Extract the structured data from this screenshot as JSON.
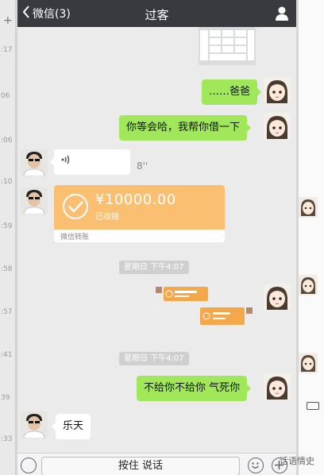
{
  "left_strip": {
    "times": [
      ":17",
      "06",
      ":06",
      ":10",
      ":59",
      ":58",
      ":57",
      ":41",
      "39",
      ":33"
    ],
    "plus": "+"
  },
  "header": {
    "back_label": "微信(3)",
    "title": "过客"
  },
  "messages": {
    "m1": "……爸爸",
    "m2": "你等会哈，我帮你借一下",
    "voice_duration": "8''",
    "transfer_amount": "¥10000.00",
    "transfer_status": "已收钱",
    "transfer_footer": "微信转账",
    "time1": "星期日 下午4:07",
    "time2": "星期日 下午4:07",
    "m3": "不给你不给你 气死你",
    "m4": "乐天"
  },
  "bottom": {
    "hold_label": "按住 说话"
  },
  "watermark": "话语情史",
  "colors": {
    "green_bubble": "#a0e75a",
    "transfer_orange": "#fbbf72",
    "topbar": "#393a3f"
  },
  "icons": {
    "back": "chevron-left-icon",
    "user": "user-icon",
    "keyboard": "keyboard-icon",
    "emoji": "emoji-icon",
    "plus": "plus-icon",
    "voice": "voice-wave-icon",
    "check": "check-circle-icon"
  }
}
